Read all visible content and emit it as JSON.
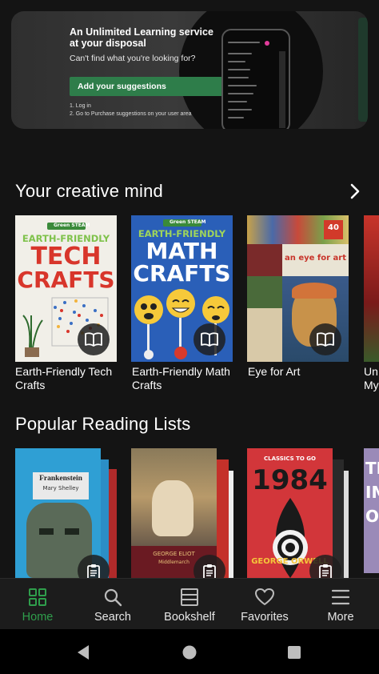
{
  "banner": {
    "title": "An Unlimited Learning service at your disposal",
    "subtitle": "Can't find what you're looking for?",
    "button_label": "Add your suggestions",
    "step1": "1. Log in",
    "step2": "2. Go to Purchase suggestions on your user area"
  },
  "sections": {
    "creative": {
      "title": "Your creative mind",
      "books": [
        {
          "title": "Earth-Friendly Tech Crafts",
          "cover_line1": "EARTH-FRIENDLY",
          "cover_line2": "TECH",
          "cover_line3": "CRAFTS",
          "series": "Green STEAM"
        },
        {
          "title": "Earth-Friendly Math Crafts",
          "cover_line1": "EARTH-FRIENDLY",
          "cover_line2": "MATH",
          "cover_line3": "CRAFTS",
          "series": "Green STEAM"
        },
        {
          "title": "Eye for Art",
          "cover_line1": "an eye for art",
          "cover_badge": "40"
        },
        {
          "title": "Un My"
        }
      ]
    },
    "popular": {
      "title": "Popular Reading Lists",
      "lists": [
        {
          "cover_title": "Frankenstein",
          "cover_author": "Mary Shelley"
        },
        {
          "cover_author": "GEORGE ELIOT",
          "cover_title": "Middlemarch"
        },
        {
          "cover_series": "CLASSICS TO GO",
          "cover_title": "1984",
          "cover_author": "GEORGE ORWELL"
        },
        {
          "cover_title": "THE IMP OF"
        }
      ]
    }
  },
  "nav": {
    "home": "Home",
    "search": "Search",
    "bookshelf": "Bookshelf",
    "favorites": "Favorites",
    "more": "More"
  },
  "colors": {
    "accent": "#2f9e4c",
    "banner_button": "#2e7d4a",
    "background": "#141414"
  }
}
